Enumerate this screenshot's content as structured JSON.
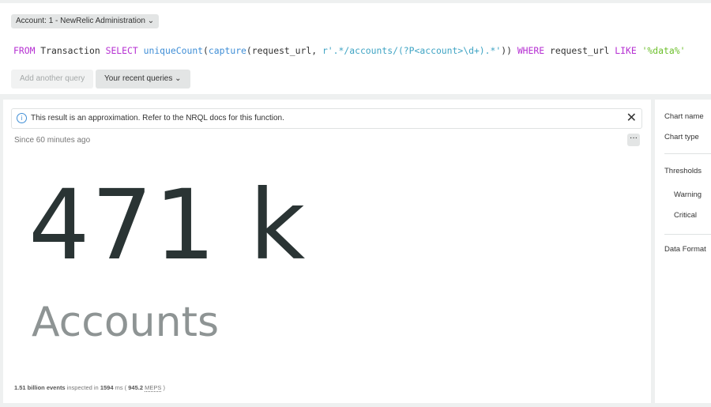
{
  "header": {
    "account_selector": "Account: 1 - NewRelic Administration",
    "query": {
      "from": "FROM",
      "table": " Transaction ",
      "select": "SELECT",
      "fn1": " uniqueCount",
      "p1": "(",
      "fn2": "capture",
      "p2": "(request_url, ",
      "regex": "r'.*/accounts/(?P<account>\\d+).*'",
      "p3": ")) ",
      "where": "WHERE",
      "field": " request_url ",
      "like": "LIKE",
      "value": " '%data%'"
    },
    "add_query": "Add another query",
    "recent_queries": "Your recent queries"
  },
  "result": {
    "notice": "This result is an approximation. Refer to the NRQL docs for this function.",
    "since": "Since 60 minutes ago",
    "more": "···",
    "value": "471 k",
    "unit": "Accounts",
    "footer": {
      "events": "1.51 billion events",
      "inspected": " inspected in ",
      "ms": "1594",
      "ms_label": " ms ( ",
      "meps": "945.2",
      "meps_label": "MEPS",
      "close": " )"
    }
  },
  "sidebar": {
    "chart_name": "Chart name",
    "chart_type": "Chart type",
    "thresholds": "Thresholds",
    "warning": "Warning",
    "critical": "Critical",
    "data_format": "Data Format"
  }
}
